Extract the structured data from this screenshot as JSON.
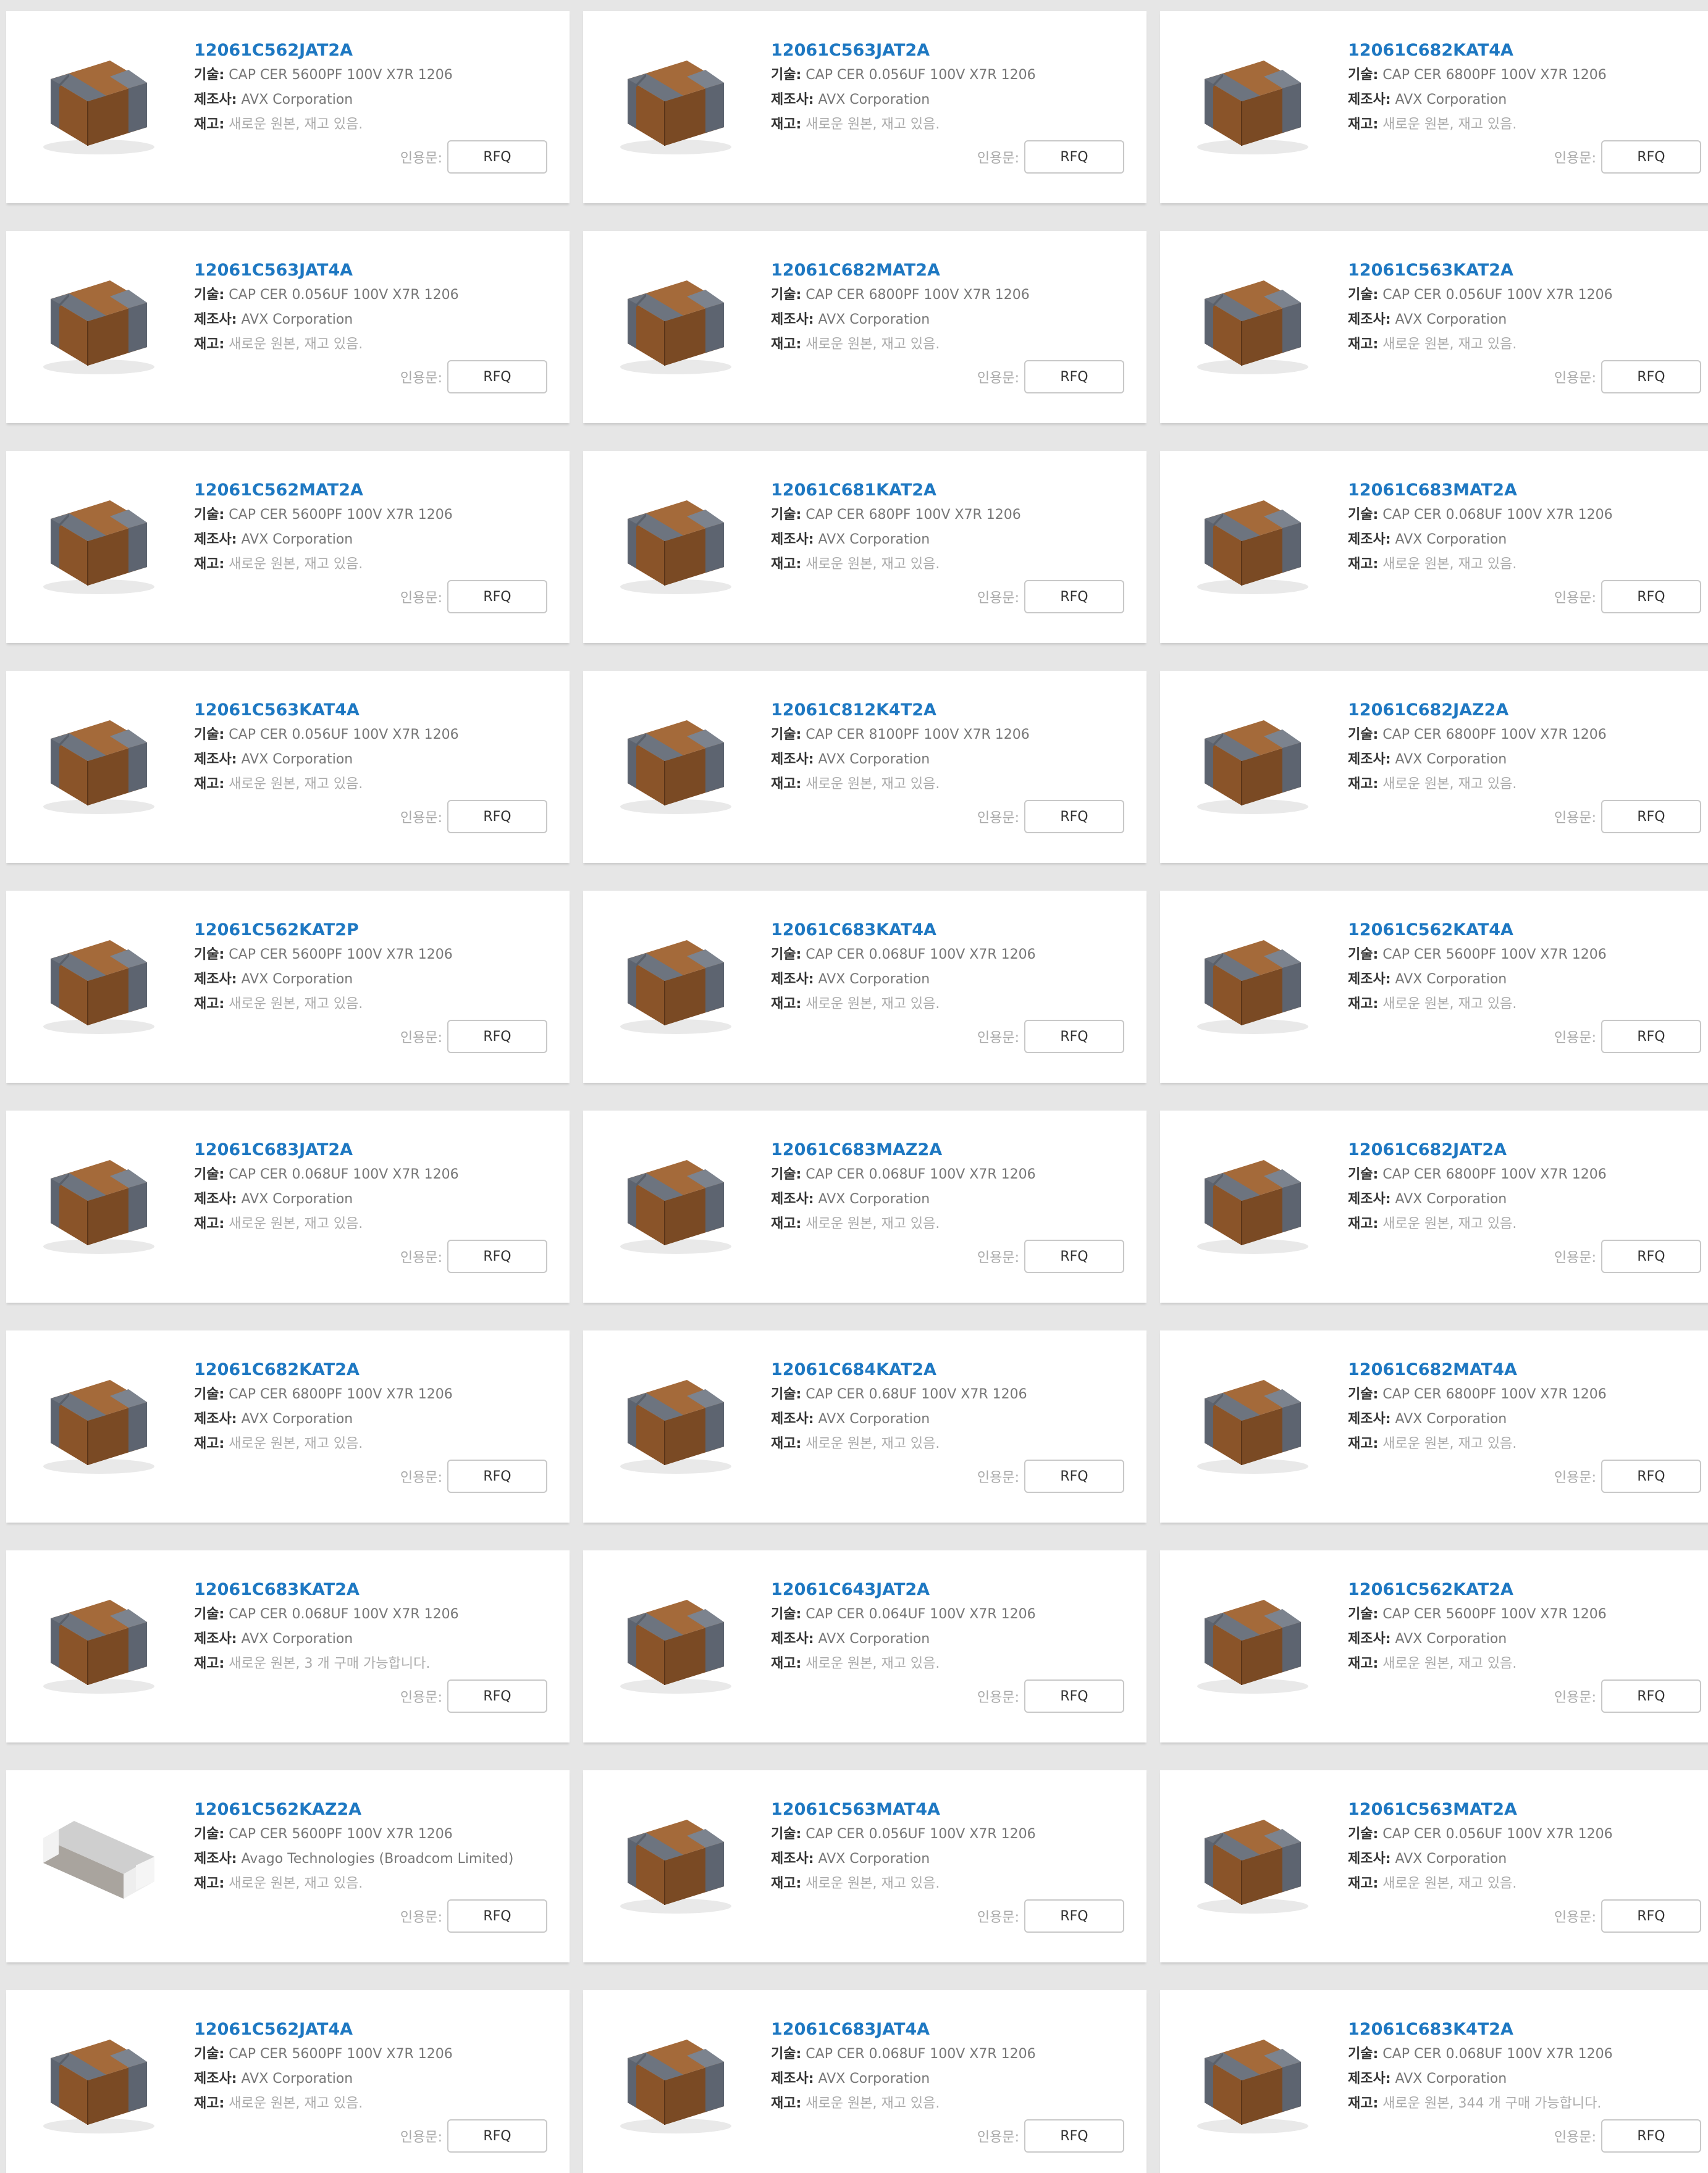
{
  "labels": {
    "desc": "기술:",
    "mfr": "제조사:",
    "stock": "재고:",
    "quote": "인용문:",
    "rfq": "RFQ"
  },
  "products": [
    {
      "pn": "12061C562JAT2A",
      "desc": "CAP CER 5600PF 100V X7R 1206",
      "mfr": "AVX Corporation",
      "stock": "새로운 원본, 재고 있음.",
      "image": "avx-mlcc-brown"
    },
    {
      "pn": "12061C563JAT2A",
      "desc": "CAP CER 0.056UF 100V X7R 1206",
      "mfr": "AVX Corporation",
      "stock": "새로운 원본, 재고 있음.",
      "image": "avx-mlcc-brown"
    },
    {
      "pn": "12061C682KAT4A",
      "desc": "CAP CER 6800PF 100V X7R 1206",
      "mfr": "AVX Corporation",
      "stock": "새로운 원본, 재고 있음.",
      "image": "avx-mlcc-brown"
    },
    {
      "pn": "12061C563JAT4A",
      "desc": "CAP CER 0.056UF 100V X7R 1206",
      "mfr": "AVX Corporation",
      "stock": "새로운 원본, 재고 있음.",
      "image": "avx-mlcc-brown"
    },
    {
      "pn": "12061C682MAT2A",
      "desc": "CAP CER 6800PF 100V X7R 1206",
      "mfr": "AVX Corporation",
      "stock": "새로운 원본, 재고 있음.",
      "image": "avx-mlcc-brown"
    },
    {
      "pn": "12061C563KAT2A",
      "desc": "CAP CER 0.056UF 100V X7R 1206",
      "mfr": "AVX Corporation",
      "stock": "새로운 원본, 재고 있음.",
      "image": "avx-mlcc-brown"
    },
    {
      "pn": "12061C562MAT2A",
      "desc": "CAP CER 5600PF 100V X7R 1206",
      "mfr": "AVX Corporation",
      "stock": "새로운 원본, 재고 있음.",
      "image": "avx-mlcc-brown"
    },
    {
      "pn": "12061C681KAT2A",
      "desc": "CAP CER 680PF 100V X7R 1206",
      "mfr": "AVX Corporation",
      "stock": "새로운 원본, 재고 있음.",
      "image": "avx-mlcc-brown"
    },
    {
      "pn": "12061C683MAT2A",
      "desc": "CAP CER 0.068UF 100V X7R 1206",
      "mfr": "AVX Corporation",
      "stock": "새로운 원본, 재고 있음.",
      "image": "avx-mlcc-brown"
    },
    {
      "pn": "12061C563KAT4A",
      "desc": "CAP CER 0.056UF 100V X7R 1206",
      "mfr": "AVX Corporation",
      "stock": "새로운 원본, 재고 있음.",
      "image": "avx-mlcc-brown"
    },
    {
      "pn": "12061C812K4T2A",
      "desc": "CAP CER 8100PF 100V X7R 1206",
      "mfr": "AVX Corporation",
      "stock": "새로운 원본, 재고 있음.",
      "image": "avx-mlcc-brown"
    },
    {
      "pn": "12061C682JAZ2A",
      "desc": "CAP CER 6800PF 100V X7R 1206",
      "mfr": "AVX Corporation",
      "stock": "새로운 원본, 재고 있음.",
      "image": "avx-mlcc-brown"
    },
    {
      "pn": "12061C562KAT2P",
      "desc": "CAP CER 5600PF 100V X7R 1206",
      "mfr": "AVX Corporation",
      "stock": "새로운 원본, 재고 있음.",
      "image": "avx-mlcc-brown"
    },
    {
      "pn": "12061C683KAT4A",
      "desc": "CAP CER 0.068UF 100V X7R 1206",
      "mfr": "AVX Corporation",
      "stock": "새로운 원본, 재고 있음.",
      "image": "avx-mlcc-brown"
    },
    {
      "pn": "12061C562KAT4A",
      "desc": "CAP CER 5600PF 100V X7R 1206",
      "mfr": "AVX Corporation",
      "stock": "새로운 원본, 재고 있음.",
      "image": "avx-mlcc-brown"
    },
    {
      "pn": "12061C683JAT2A",
      "desc": "CAP CER 0.068UF 100V X7R 1206",
      "mfr": "AVX Corporation",
      "stock": "새로운 원본, 재고 있음.",
      "image": "avx-mlcc-brown"
    },
    {
      "pn": "12061C683MAZ2A",
      "desc": "CAP CER 0.068UF 100V X7R 1206",
      "mfr": "AVX Corporation",
      "stock": "새로운 원본, 재고 있음.",
      "image": "avx-mlcc-brown"
    },
    {
      "pn": "12061C682JAT2A",
      "desc": "CAP CER 6800PF 100V X7R 1206",
      "mfr": "AVX Corporation",
      "stock": "새로운 원본, 재고 있음.",
      "image": "avx-mlcc-brown"
    },
    {
      "pn": "12061C682KAT2A",
      "desc": "CAP CER 6800PF 100V X7R 1206",
      "mfr": "AVX Corporation",
      "stock": "새로운 원본, 재고 있음.",
      "image": "avx-mlcc-brown"
    },
    {
      "pn": "12061C684KAT2A",
      "desc": "CAP CER 0.68UF 100V X7R 1206",
      "mfr": "AVX Corporation",
      "stock": "새로운 원본, 재고 있음.",
      "image": "avx-mlcc-brown"
    },
    {
      "pn": "12061C682MAT4A",
      "desc": "CAP CER 6800PF 100V X7R 1206",
      "mfr": "AVX Corporation",
      "stock": "새로운 원본, 재고 있음.",
      "image": "avx-mlcc-brown"
    },
    {
      "pn": "12061C683KAT2A",
      "desc": "CAP CER 0.068UF 100V X7R 1206",
      "mfr": "AVX Corporation",
      "stock": "새로운 원본, 3 개 구매 가능합니다.",
      "image": "avx-mlcc-brown"
    },
    {
      "pn": "12061C643JAT2A",
      "desc": "CAP CER 0.064UF 100V X7R 1206",
      "mfr": "AVX Corporation",
      "stock": "새로운 원본, 재고 있음.",
      "image": "avx-mlcc-brown"
    },
    {
      "pn": "12061C562KAT2A",
      "desc": "CAP CER 5600PF 100V X7R 1206",
      "mfr": "AVX Corporation",
      "stock": "새로운 원본, 재고 있음.",
      "image": "avx-mlcc-brown"
    },
    {
      "pn": "12061C562KAZ2A",
      "desc": "CAP CER 5600PF 100V X7R 1206",
      "mfr": "Avago Technologies (Broadcom Limited)",
      "stock": "새로운 원본, 재고 있음.",
      "image": "avago-mlcc-grey"
    },
    {
      "pn": "12061C563MAT4A",
      "desc": "CAP CER 0.056UF 100V X7R 1206",
      "mfr": "AVX Corporation",
      "stock": "새로운 원본, 재고 있음.",
      "image": "avx-mlcc-brown"
    },
    {
      "pn": "12061C563MAT2A",
      "desc": "CAP CER 0.056UF 100V X7R 1206",
      "mfr": "AVX Corporation",
      "stock": "새로운 원본, 재고 있음.",
      "image": "avx-mlcc-brown"
    },
    {
      "pn": "12061C562JAT4A",
      "desc": "CAP CER 5600PF 100V X7R 1206",
      "mfr": "AVX Corporation",
      "stock": "새로운 원본, 재고 있음.",
      "image": "avx-mlcc-brown"
    },
    {
      "pn": "12061C683JAT4A",
      "desc": "CAP CER 0.068UF 100V X7R 1206",
      "mfr": "AVX Corporation",
      "stock": "새로운 원본, 재고 있음.",
      "image": "avx-mlcc-brown"
    },
    {
      "pn": "12061C683K4T2A",
      "desc": "CAP CER 0.068UF 100V X7R 1206",
      "mfr": "AVX Corporation",
      "stock": "새로운 원본, 344 개 구매 가능합니다.",
      "image": "avx-mlcc-brown"
    }
  ],
  "colors": {
    "part_number_link": "#1e78c2",
    "page_background": "#e6e6e6",
    "card_background": "#ffffff",
    "capacitor_body": "#8a5429",
    "capacitor_terminal": "#5d6470"
  }
}
